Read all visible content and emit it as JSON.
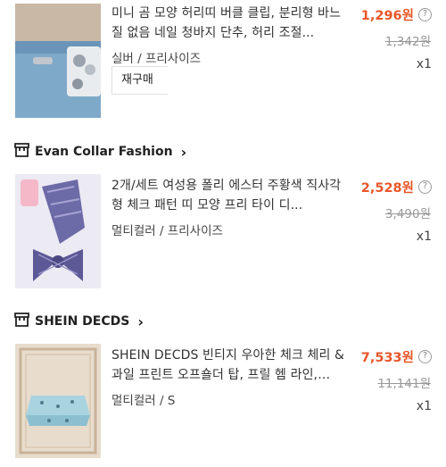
{
  "items": [
    {
      "title": "미니 곰 모양 허리띠 버클 클립, 분리형 바느질 없음 네일 청바지 단추, 허리 조절...",
      "variant": "실버 / 프리사이즈",
      "price": "1,296원",
      "original_price": "1,342원",
      "quantity": "x1",
      "rebuy_label": "재구매"
    },
    {
      "title": "2개/세트 여성용 폴리 에스터 주황색 직사각형 체크 패턴 띠 모양 프리 타이 디...",
      "variant": "멀티컬러 / 프리사이즈",
      "price": "2,528원",
      "original_price": "3,490원",
      "quantity": "x1"
    },
    {
      "title": "SHEIN DECDS 빈티지 우아한 체크 체리 & 과일 프린트 오프숄더 탑, 프릴 헴 라인, 소...",
      "variant": "멀티컬러 / S",
      "price": "7,533원",
      "original_price": "11,141원",
      "quantity": "x1"
    }
  ],
  "stores": [
    {
      "name": "Evan Collar Fashion",
      "icon": "store-icon"
    },
    {
      "name": "SHEIN DECDS",
      "icon": "store-icon"
    }
  ],
  "help_glyph": "?",
  "chevron_glyph": "›",
  "colors": {
    "price": "#e8562a",
    "strike": "#999999"
  }
}
